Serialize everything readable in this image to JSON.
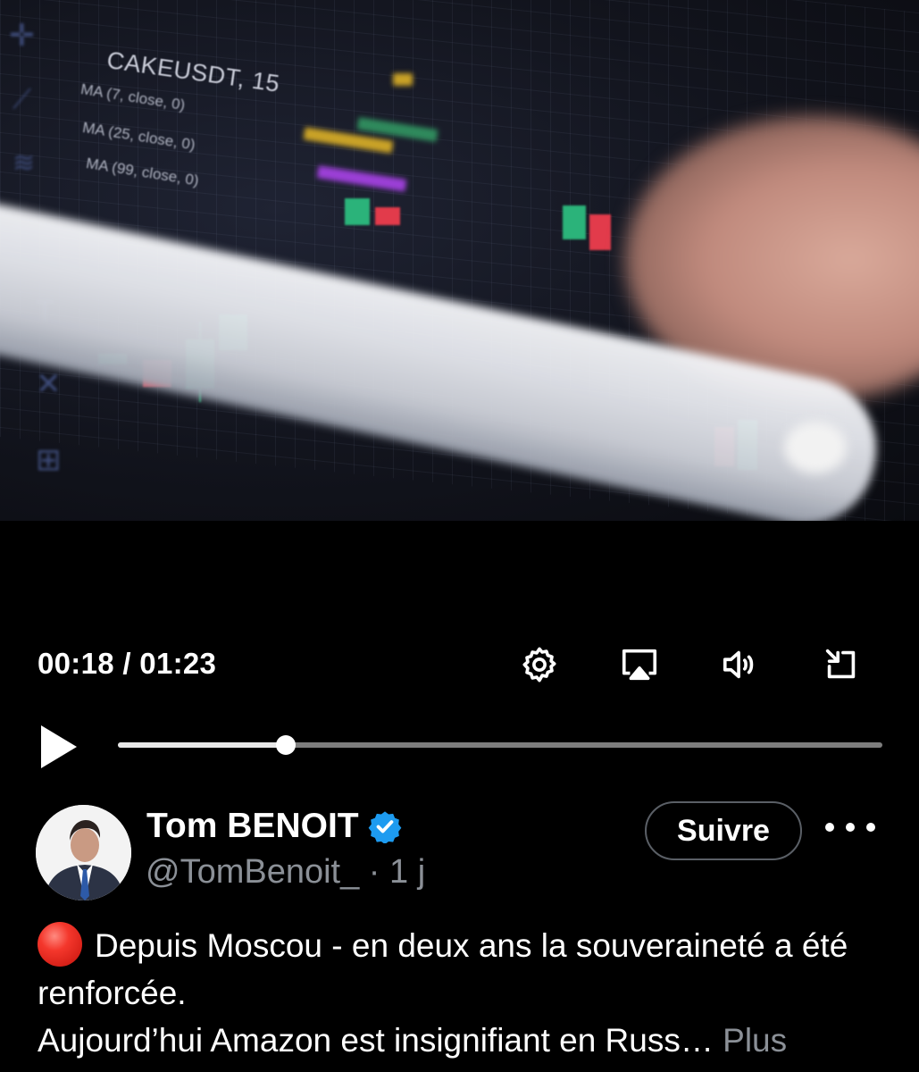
{
  "video": {
    "chart_symbol": "CAKEUSDT, 15",
    "indicators": [
      "MA (7, close, 0)",
      "MA (25, close, 0)",
      "MA (99, close, 0)"
    ]
  },
  "player": {
    "current_time": "00:18",
    "duration": "01:23",
    "time_display": "00:18 / 01:23",
    "progress": 0.22,
    "icons": [
      "settings-gear-icon",
      "airplay-icon",
      "volume-icon",
      "exit-fullscreen-icon",
      "play-icon"
    ]
  },
  "tweet": {
    "author_name": "Tom BENOIT",
    "handle_line": "@TomBenoit_ · 1 j",
    "verified": true,
    "verified_color": "#1d9bf0",
    "follow_label": "Suivre",
    "text_line1": "Depuis Moscou - en deux ans la souveraineté a été renforcée.",
    "text_line2": "Aujourd’hui Amazon est insignifiant en Russ…",
    "more_label": "Plus"
  },
  "colors": {
    "background": "#000000",
    "secondary_text": "#8b9097",
    "track": "#7d7d7d"
  }
}
